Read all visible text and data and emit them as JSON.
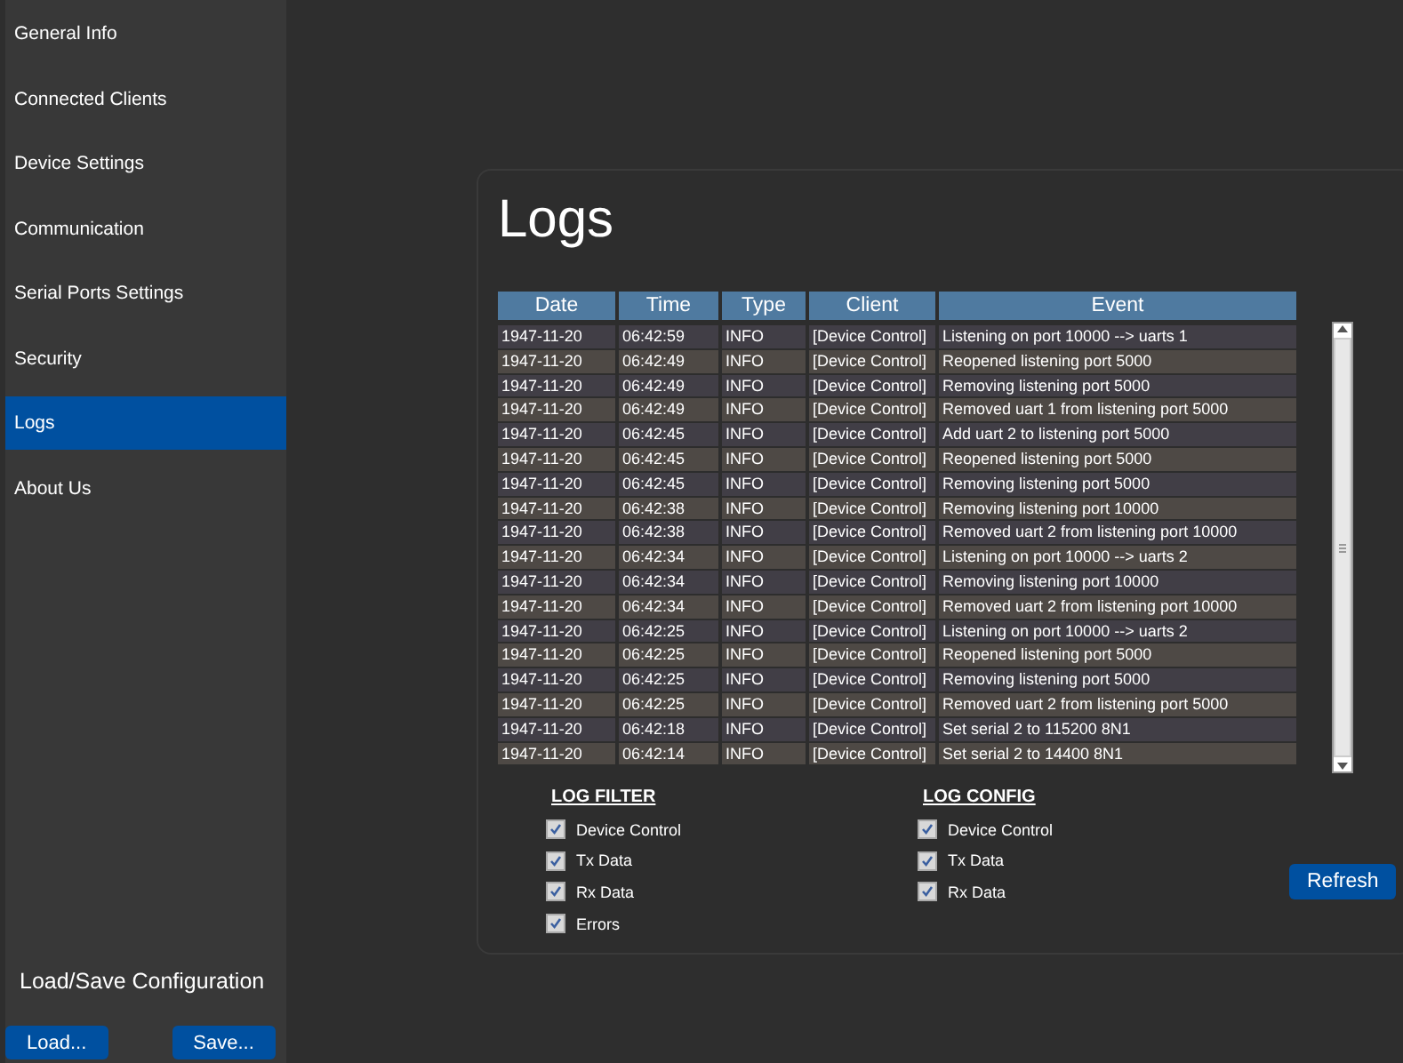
{
  "sidebar": {
    "items": [
      {
        "label": "General Info",
        "selected": false
      },
      {
        "label": "Connected Clients",
        "selected": false
      },
      {
        "label": "Device Settings",
        "selected": false
      },
      {
        "label": "Communication",
        "selected": false
      },
      {
        "label": "Serial Ports Settings",
        "selected": false
      },
      {
        "label": "Security",
        "selected": false
      },
      {
        "label": "Logs",
        "selected": true
      },
      {
        "label": "About Us",
        "selected": false
      }
    ],
    "config_title": "Load/Save Configuration",
    "buttons": [
      "Load...",
      "Save..."
    ]
  },
  "page": {
    "title": "Logs",
    "table": {
      "columns": [
        "Date",
        "Time",
        "Type",
        "Client",
        "Event"
      ],
      "rows": [
        [
          "1947-11-20",
          "06:42:59",
          "INFO",
          "[Device Control]",
          "Listening on port 10000 --> uarts 1"
        ],
        [
          "1947-11-20",
          "06:42:49",
          "INFO",
          "[Device Control]",
          "Reopened listening port 5000"
        ],
        [
          "1947-11-20",
          "06:42:49",
          "INFO",
          "[Device Control]",
          "Removing listening port 5000"
        ],
        [
          "1947-11-20",
          "06:42:49",
          "INFO",
          "[Device Control]",
          "Removed uart 1 from listening port 5000"
        ],
        [
          "1947-11-20",
          "06:42:45",
          "INFO",
          "[Device Control]",
          "Add uart 2 to listening port 5000"
        ],
        [
          "1947-11-20",
          "06:42:45",
          "INFO",
          "[Device Control]",
          "Reopened listening port 5000"
        ],
        [
          "1947-11-20",
          "06:42:45",
          "INFO",
          "[Device Control]",
          "Removing listening port 5000"
        ],
        [
          "1947-11-20",
          "06:42:38",
          "INFO",
          "[Device Control]",
          "Removing listening port 10000"
        ],
        [
          "1947-11-20",
          "06:42:38",
          "INFO",
          "[Device Control]",
          "Removed uart 2 from listening port 10000"
        ],
        [
          "1947-11-20",
          "06:42:34",
          "INFO",
          "[Device Control]",
          "Listening on port 10000 --> uarts 2"
        ],
        [
          "1947-11-20",
          "06:42:34",
          "INFO",
          "[Device Control]",
          "Removing listening port 10000"
        ],
        [
          "1947-11-20",
          "06:42:34",
          "INFO",
          "[Device Control]",
          "Removed uart 2 from listening port 10000"
        ],
        [
          "1947-11-20",
          "06:42:25",
          "INFO",
          "[Device Control]",
          "Listening on port 10000 --> uarts 2"
        ],
        [
          "1947-11-20",
          "06:42:25",
          "INFO",
          "[Device Control]",
          "Reopened listening port 5000"
        ],
        [
          "1947-11-20",
          "06:42:25",
          "INFO",
          "[Device Control]",
          "Removing listening port 5000"
        ],
        [
          "1947-11-20",
          "06:42:25",
          "INFO",
          "[Device Control]",
          "Removed uart 2 from listening port 5000"
        ],
        [
          "1947-11-20",
          "06:42:18",
          "INFO",
          "[Device Control]",
          "Set serial 2 to 115200 8N1"
        ],
        [
          "1947-11-20",
          "06:42:14",
          "INFO",
          "[Device Control]",
          "Set serial 2 to 14400 8N1"
        ]
      ]
    },
    "log_filter": {
      "title": "LOG FILTER",
      "options": [
        {
          "label": "Device Control",
          "checked": true
        },
        {
          "label": "Tx Data",
          "checked": true
        },
        {
          "label": "Rx Data",
          "checked": true
        },
        {
          "label": "Errors",
          "checked": true
        }
      ]
    },
    "log_config": {
      "title": "LOG CONFIG",
      "options": [
        {
          "label": "Device Control",
          "checked": true
        },
        {
          "label": "Tx Data",
          "checked": true
        },
        {
          "label": "Rx Data",
          "checked": true
        }
      ]
    },
    "refresh_button": "Refresh"
  }
}
